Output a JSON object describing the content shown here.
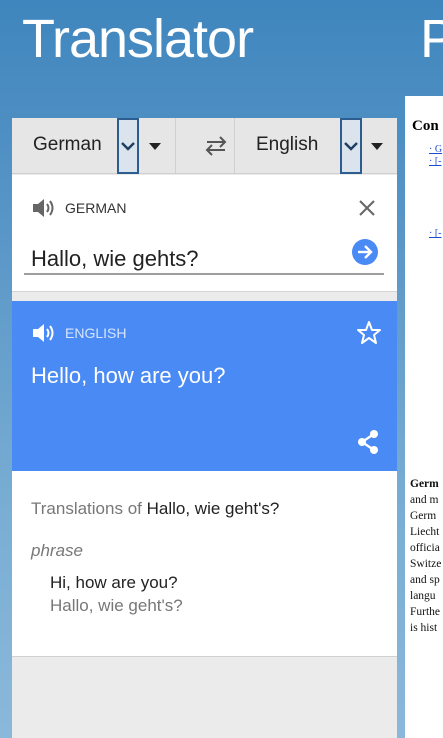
{
  "app": {
    "title": "Translator",
    "next_title": "P"
  },
  "language_bar": {
    "source_language": "German",
    "target_language": "English"
  },
  "source": {
    "language_label": "GERMAN",
    "text": "Hallo, wie gehts?"
  },
  "result": {
    "language_label": "ENGLISH",
    "text": "Hello, how are you?"
  },
  "dictionary": {
    "heading_prefix": "Translations of",
    "query": "Hallo, wie geht's?",
    "part_of_speech": "phrase",
    "entries": [
      {
        "translation": "Hi, how are you?",
        "reverse": "Hallo, wie geht's?"
      }
    ]
  },
  "peek_page": {
    "heading": "Con",
    "links": [
      "· G",
      "· [-",
      "· [-"
    ],
    "body_lines": [
      "Germ",
      "and m",
      "Germ",
      "Liecht",
      "officia",
      "Switze",
      "and sp",
      "langu",
      "Furthe",
      "is hist"
    ]
  },
  "icons": {
    "combo_chevron": "chevron-down-icon",
    "swap": "swap-arrows-icon",
    "speaker": "speaker-icon",
    "clear": "close-icon",
    "translate_go": "arrow-right-circle-icon",
    "favorite": "star-outline-icon",
    "share": "share-icon"
  },
  "colors": {
    "background": "#4f8fc4",
    "result_card": "#4a8af4",
    "go_button": "#4a8af4",
    "combo_border": "#2b5e8e"
  }
}
